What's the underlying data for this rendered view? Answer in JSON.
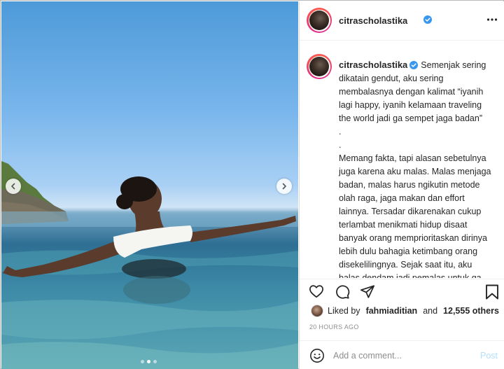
{
  "post": {
    "username": "citrascholastika",
    "verified": true,
    "caption": "Semenjak sering dikatain gendut, aku sering membalasnya dengan kalimat “iyanih lagi happy, iyanih kelamaan traveling the world jadi ga sempet jaga badan”\n.\n.\nMemang fakta, tapi alasan sebetulnya juga karena aku malas. Malas menjaga badan, malas harus ngikutin metode olah raga, jaga makan dan effort lainnya. Tersadar dikarenakan cukup terlambat menikmati hidup disaat banyak orang memprioritaskan dirinya lebih dulu bahagia ketimbang orang disekelilingnya. Sejak saat itu, aku balas dendam jadi pemalas untuk ga peduli omongan orang lain bahkan syarat menjadi “terpakai” di dunia",
    "likes": {
      "liked_by_prefix": "Liked by",
      "liked_by_user": "fahmiaditian",
      "and": "and",
      "others": "12,555 others"
    },
    "timestamp": "20 HOURS AGO",
    "carousel": {
      "count": 3,
      "active_index": 1
    }
  },
  "comment": {
    "placeholder": "Add a comment...",
    "post_label": "Post"
  },
  "icons": {
    "more": "more-horizontal-icon",
    "like": "heart-icon",
    "comment": "comment-bubble-icon",
    "share": "paper-plane-icon",
    "save": "bookmark-icon",
    "emoji": "smiley-icon",
    "verified": "verified-badge-icon",
    "prev": "chevron-left-icon",
    "next": "chevron-right-icon"
  },
  "colors": {
    "verified_blue": "#3897f0",
    "post_disabled": "#b2dffc",
    "muted_text": "#8e8e8e"
  }
}
